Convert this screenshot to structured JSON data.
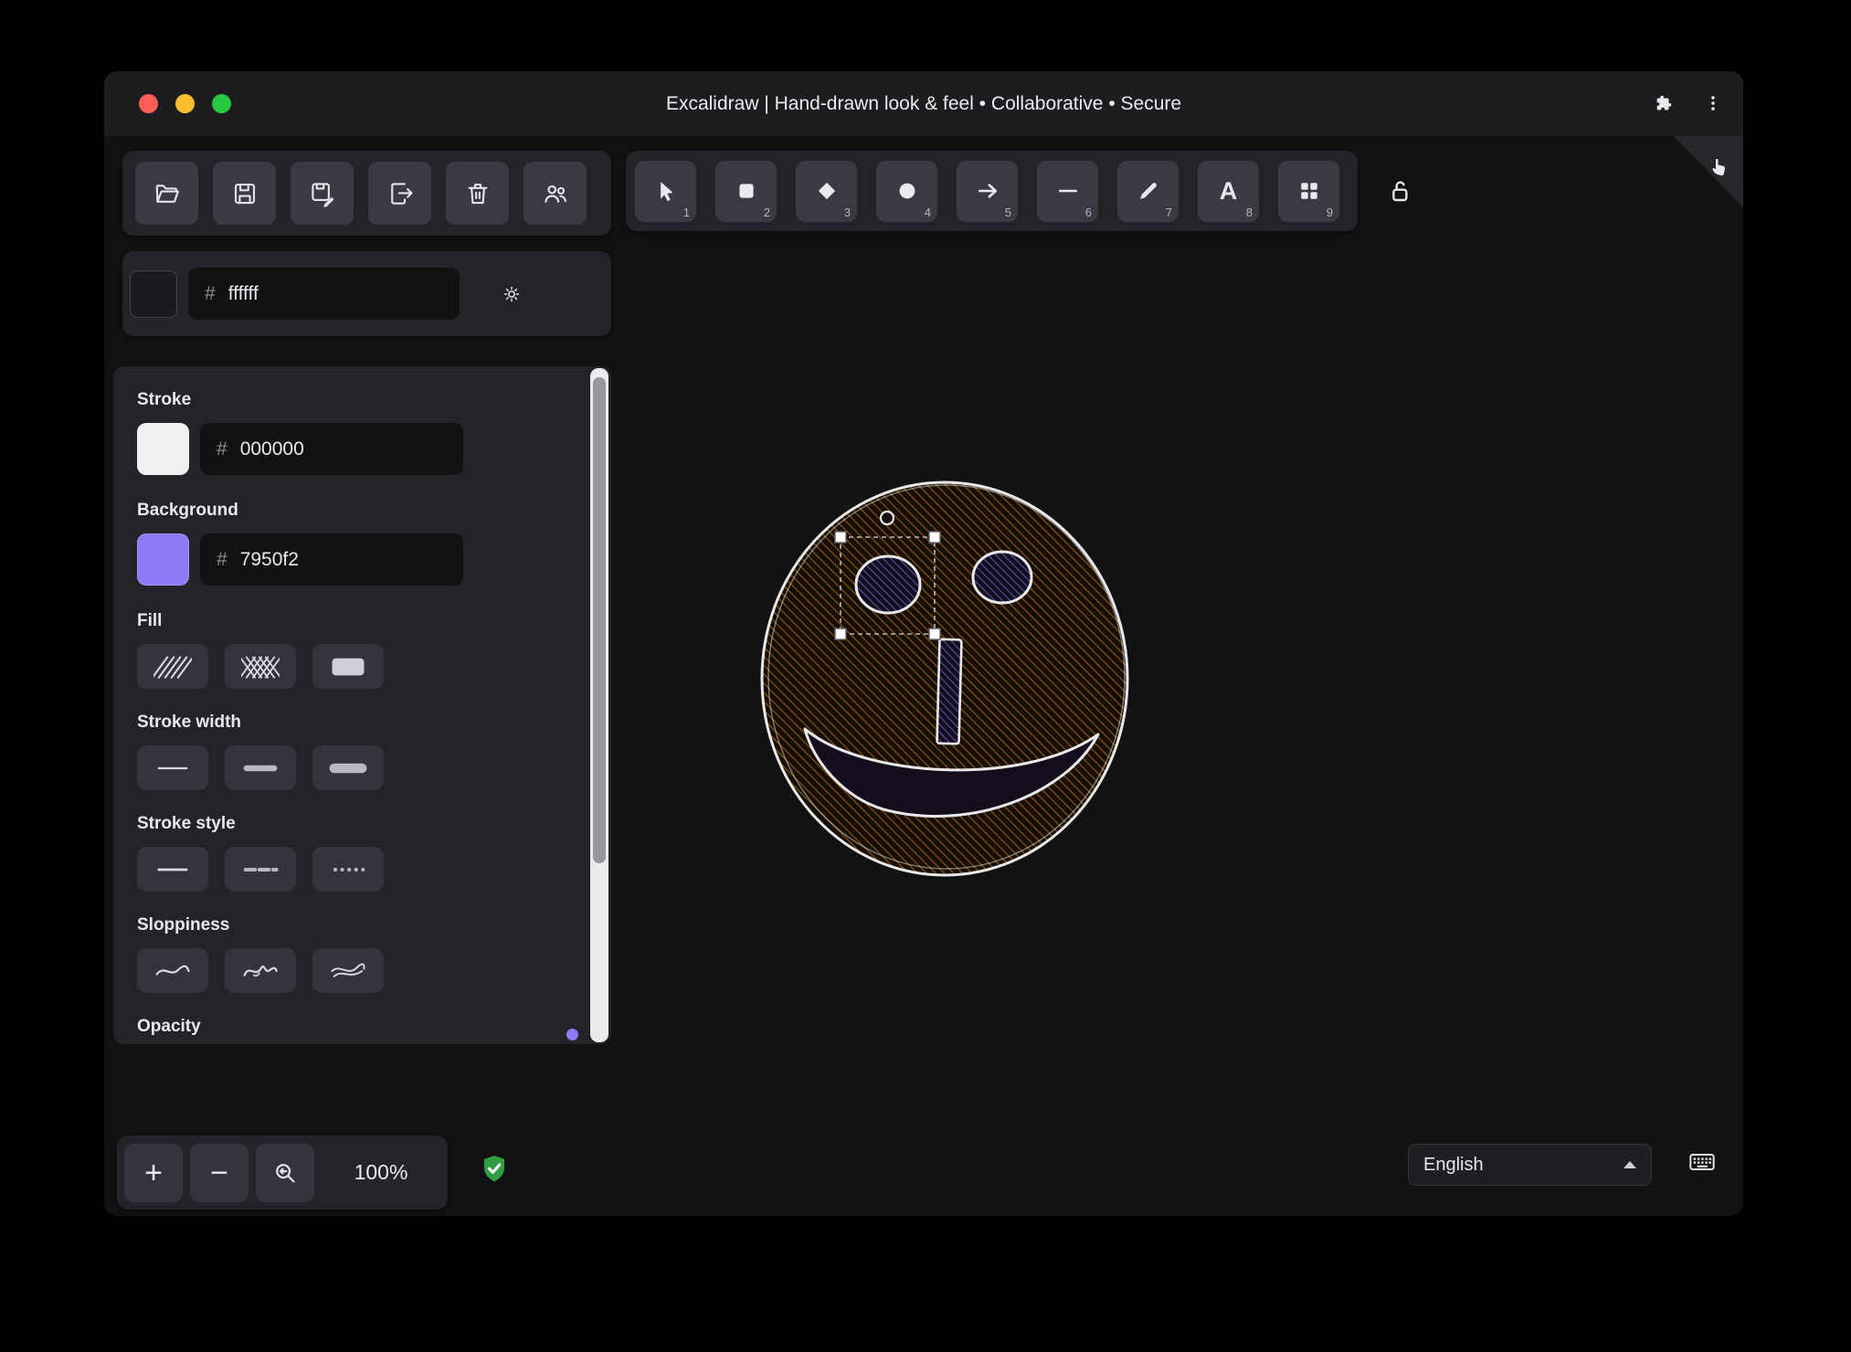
{
  "titlebar": {
    "title": "Excalidraw | Hand-drawn look & feel • Collaborative • Secure"
  },
  "file_actions": {
    "buttons": [
      "open-file",
      "save-file",
      "save-as",
      "export-image",
      "delete-canvas",
      "live-collaboration"
    ]
  },
  "canvas_background": {
    "hash": "#",
    "value": "ffffff"
  },
  "toolbar": {
    "tools": [
      {
        "name": "selection",
        "shortcut": "1"
      },
      {
        "name": "rectangle",
        "shortcut": "2"
      },
      {
        "name": "diamond",
        "shortcut": "3"
      },
      {
        "name": "ellipse",
        "shortcut": "4"
      },
      {
        "name": "arrow",
        "shortcut": "5"
      },
      {
        "name": "line",
        "shortcut": "6"
      },
      {
        "name": "draw",
        "shortcut": "7"
      },
      {
        "name": "text",
        "shortcut": "8",
        "glyph": "A"
      },
      {
        "name": "shapes",
        "shortcut": "9"
      }
    ],
    "lock": "keep-selected-tool-active"
  },
  "properties_panel": {
    "stroke": {
      "label": "Stroke",
      "hash": "#",
      "value": "000000"
    },
    "background": {
      "label": "Background",
      "hash": "#",
      "value": "7950f2"
    },
    "fill": {
      "label": "Fill",
      "options": [
        "hachure",
        "cross-hatch",
        "solid"
      ]
    },
    "stroke_width": {
      "label": "Stroke width",
      "options": [
        "thin",
        "bold",
        "extra-bold"
      ]
    },
    "stroke_style": {
      "label": "Stroke style",
      "options": [
        "solid",
        "dashed",
        "dotted"
      ]
    },
    "sloppiness": {
      "label": "Sloppiness",
      "options": [
        "architect",
        "artist",
        "cartoonist"
      ]
    },
    "opacity": {
      "label": "Opacity"
    }
  },
  "footer": {
    "zoom_in": "+",
    "zoom_out": "−",
    "zoom_level": "100%",
    "language": {
      "value": "English"
    },
    "encrypted": "end-to-end encrypted"
  },
  "colors": {
    "accent": "#8c7bf4",
    "background_swatch": "#8c7bf4",
    "stroke_swatch": "#f0f0f2",
    "canvas_swatch": "#1b1b1f",
    "shield_green": "#2f9e44",
    "face_hatch": "#8a5412",
    "eye_hatch": "#6c5fc0"
  }
}
